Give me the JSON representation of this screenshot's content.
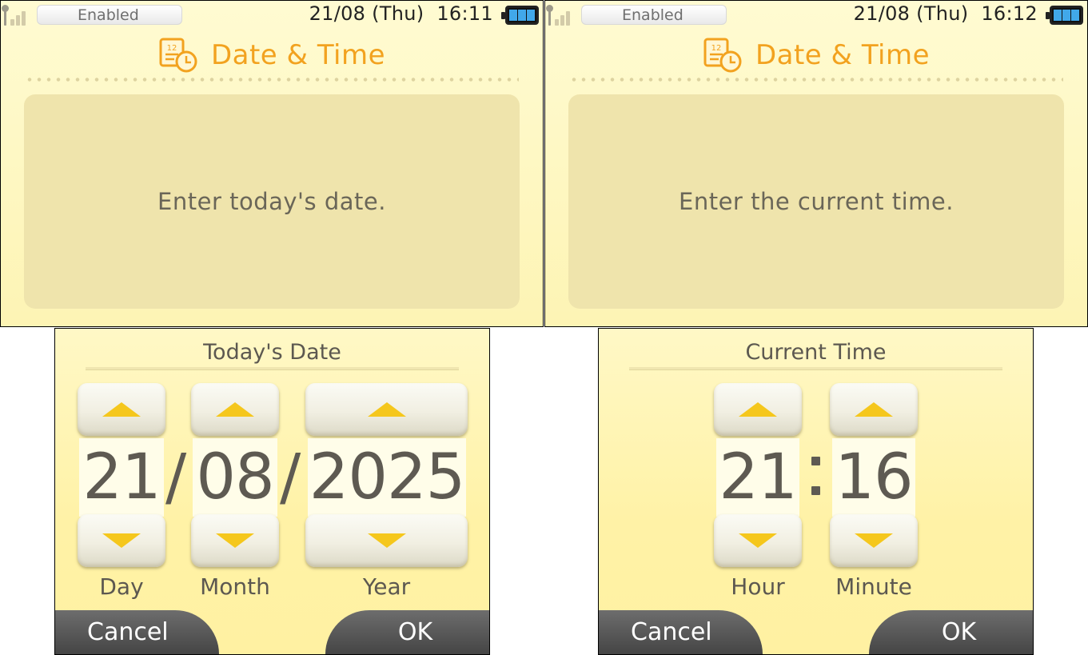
{
  "top_screens": [
    {
      "status": {
        "wifi_label": "Enabled",
        "date": "21/08 (Thu)",
        "time": "16:11"
      },
      "title": "Date & Time",
      "message": "Enter today's date."
    },
    {
      "status": {
        "wifi_label": "Enabled",
        "date": "21/08 (Thu)",
        "time": "16:12"
      },
      "title": "Date & Time",
      "message": "Enter the current time."
    }
  ],
  "date_screen": {
    "title": "Today's Date",
    "day": {
      "value": "21",
      "label": "Day"
    },
    "month": {
      "value": "08",
      "label": "Month"
    },
    "year": {
      "value": "2025",
      "label": "Year"
    },
    "separator": "/",
    "cancel_label": "Cancel",
    "ok_label": "OK"
  },
  "time_screen": {
    "title": "Current Time",
    "hour": {
      "value": "21",
      "label": "Hour"
    },
    "minute": {
      "value": "16",
      "label": "Minute"
    },
    "cancel_label": "Cancel",
    "ok_label": "OK"
  },
  "icons": {
    "signal": "signal-strength-icon",
    "battery": "battery-icon",
    "title": "calendar-clock-icon",
    "up": "arrow-up-icon",
    "down": "arrow-down-icon"
  },
  "colors": {
    "accent": "#f2a21f",
    "arrow": "#f5c71c",
    "battery": "#41a8ea"
  }
}
